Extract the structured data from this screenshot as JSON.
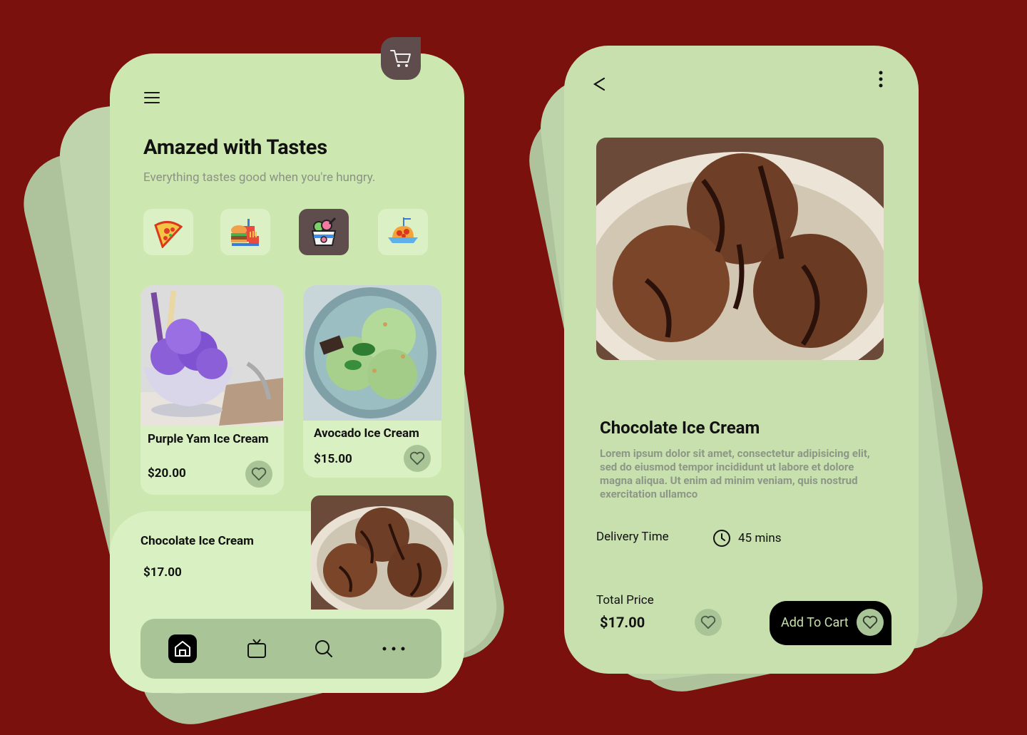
{
  "home": {
    "title": "Amazed with Tastes",
    "subtitle": "Everything tastes good when you're hungry.",
    "categories": [
      {
        "icon": "pizza-icon",
        "active": false
      },
      {
        "icon": "fast-food-icon",
        "active": false
      },
      {
        "icon": "ice-cream-icon",
        "active": true
      },
      {
        "icon": "spaghetti-icon",
        "active": false
      }
    ],
    "products": [
      {
        "name": "Purple Yam Ice Cream",
        "price": "$20.00"
      },
      {
        "name": "Avocado Ice Cream",
        "price": "$15.00"
      },
      {
        "name": "Chocolate Ice Cream",
        "price": "$17.00"
      }
    ],
    "nav": [
      "home-icon",
      "tv-icon",
      "search-icon",
      "more-icon"
    ]
  },
  "detail": {
    "title": "Chocolate Ice Cream",
    "description": "Lorem ipsum dolor sit amet, consectetur adipisicing elit, sed do eiusmod tempor incididunt ut labore et dolore magna aliqua. Ut enim ad minim veniam, quis nostrud exercitation ullamco",
    "delivery_label": "Delivery Time",
    "delivery_value": "45 mins",
    "total_label": "Total Price",
    "total_value": "$17.00",
    "add_to_cart": "Add To Cart"
  },
  "colors": {
    "background": "#7a110c",
    "card": "#cde7b0",
    "accent_dark": "#5f4c4c",
    "heart_bg": "#a9c597"
  }
}
